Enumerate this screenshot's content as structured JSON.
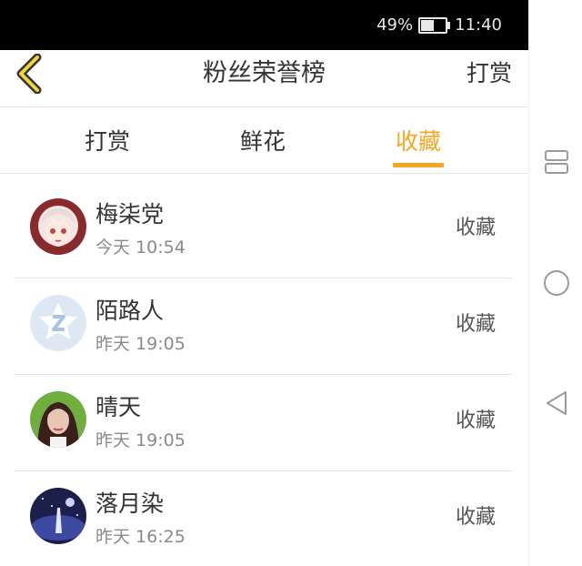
{
  "status_bar": {
    "battery": "49%",
    "battery_level": 0.49,
    "time": "11:40"
  },
  "header": {
    "title": "粉丝荣誉榜",
    "back_icon": "chevron-left-icon",
    "action_label": "打赏"
  },
  "tabs": [
    {
      "label": "打赏",
      "active": false
    },
    {
      "label": "鲜花",
      "active": false
    },
    {
      "label": "收藏",
      "active": true
    }
  ],
  "colors": {
    "accent": "#f5a623",
    "text": "#333333",
    "muted": "#8a8a8a",
    "divider": "#e3e3e3"
  },
  "fans": [
    {
      "name": "梅柒党",
      "time": "今天 10:54",
      "action": "收藏",
      "avatar": "anime-girl-avatar"
    },
    {
      "name": "陌路人",
      "time": "昨天 19:05",
      "action": "收藏",
      "avatar": "default-star-avatar"
    },
    {
      "name": "晴天",
      "time": "昨天 19:05",
      "action": "收藏",
      "avatar": "woman-portrait-avatar"
    },
    {
      "name": "落月染",
      "time": "昨天 16:25",
      "action": "收藏",
      "avatar": "night-scene-avatar"
    }
  ],
  "nav_bar": {
    "icons": [
      "recent-apps-icon",
      "home-icon",
      "back-icon"
    ]
  }
}
